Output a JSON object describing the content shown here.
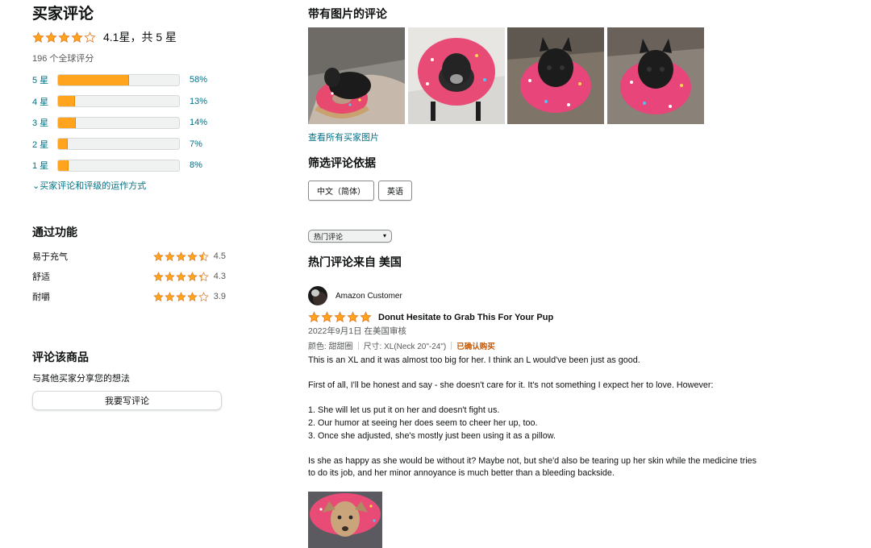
{
  "summary": {
    "title": "买家评论",
    "overall_text": "4.1星，共 5 星",
    "overall_rating": 4.1,
    "total_ratings": "196 个全球评分",
    "histogram": [
      {
        "label": "5 星",
        "pct_text": "58%",
        "pct": 58
      },
      {
        "label": "4 星",
        "pct_text": "13%",
        "pct": 13
      },
      {
        "label": "3 星",
        "pct_text": "14%",
        "pct": 14
      },
      {
        "label": "2 星",
        "pct_text": "7%",
        "pct": 7
      },
      {
        "label": "1 星",
        "pct_text": "8%",
        "pct": 8
      }
    ],
    "how_link": "买家评论和评级的运作方式"
  },
  "features": {
    "title": "通过功能",
    "items": [
      {
        "name": "易于充气",
        "value": "4.5",
        "rating": 4.5
      },
      {
        "name": "舒适",
        "value": "4.3",
        "rating": 4.3
      },
      {
        "name": "耐嚼",
        "value": "3.9",
        "rating": 3.9
      }
    ]
  },
  "write": {
    "title": "评论该商品",
    "subtitle": "与其他买家分享您的想法",
    "button": "我要写评论"
  },
  "images_section": {
    "title": "带有图片的评论",
    "see_all": "查看所有买家图片"
  },
  "filter": {
    "title": "筛选评论依据",
    "languages": [
      "中文（简体）",
      "英语"
    ]
  },
  "sort": {
    "selected": "热门评论"
  },
  "top_from": "热门评论来自 美国",
  "review": {
    "author": "Amazon Customer",
    "rating": 5,
    "title": "Donut Hesitate to Grab This For Your Pup",
    "date": "2022年9月1日 在美国审核",
    "color": "颜色: 甜甜圈",
    "size": "尺寸: XL(Neck 20\"-24\")",
    "verified": "已确认购买",
    "body": [
      "This is an XL and it was almost too big for her. I think an L would've been just as good.",
      "First of all, I'll be honest and say - she doesn't care for it. It's not something I expect her to love. However:",
      "1. She will let us put it on her and doesn't fight us.\n2. Our humor at seeing her does seem to cheer her up, too.\n3. Once she adjusted, she's mostly just been using it as a pillow.",
      "Is she as happy as she would be without it? Maybe not, but she'd also be tearing up her skin while the medicine tries to do its job, and her minor annoyance is much better than a bleeding backside."
    ]
  },
  "colors": {
    "star": "#FFA41C",
    "link": "#007185",
    "verified": "#C45500"
  }
}
